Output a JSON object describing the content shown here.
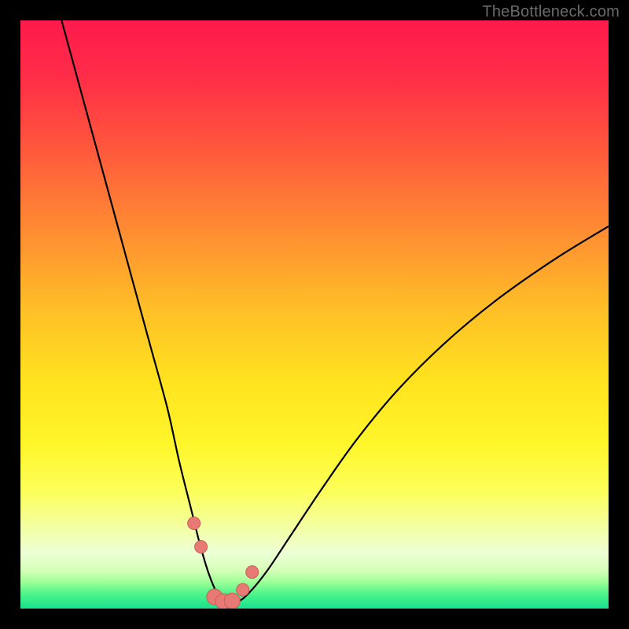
{
  "watermark": "TheBottleneck.com",
  "colors": {
    "frame_bg": "#000000",
    "curve": "#000000",
    "marker_fill": "#e77a75",
    "marker_stroke": "#cf5b56",
    "gradient_stops": [
      {
        "offset": 0.0,
        "color": "#ff1a4c"
      },
      {
        "offset": 0.1,
        "color": "#ff2e47"
      },
      {
        "offset": 0.22,
        "color": "#ff593c"
      },
      {
        "offset": 0.35,
        "color": "#ff8a33"
      },
      {
        "offset": 0.5,
        "color": "#ffc226"
      },
      {
        "offset": 0.62,
        "color": "#ffe41f"
      },
      {
        "offset": 0.72,
        "color": "#fff62a"
      },
      {
        "offset": 0.8,
        "color": "#fcff5a"
      },
      {
        "offset": 0.86,
        "color": "#f3ffa0"
      },
      {
        "offset": 0.905,
        "color": "#edffd6"
      },
      {
        "offset": 0.935,
        "color": "#d6ffb8"
      },
      {
        "offset": 0.955,
        "color": "#9dff97"
      },
      {
        "offset": 0.975,
        "color": "#4cf58a"
      },
      {
        "offset": 1.0,
        "color": "#19e08e"
      }
    ]
  },
  "chart_data": {
    "type": "line",
    "title": "",
    "xlabel": "",
    "ylabel": "",
    "xlim": [
      0,
      100
    ],
    "ylim": [
      0,
      100
    ],
    "grid": false,
    "series": [
      {
        "name": "bottleneck-curve",
        "x": [
          7,
          10,
          13,
          16,
          19,
          22,
          25,
          27,
          29,
          30.5,
          32,
          33.5,
          35,
          37,
          39,
          42,
          46,
          51,
          57,
          64,
          72,
          81,
          91,
          100
        ],
        "y": [
          100,
          89,
          78,
          67,
          56,
          45,
          34,
          25,
          17,
          11,
          6,
          2.5,
          1.2,
          1.2,
          2.8,
          6.5,
          12.5,
          20,
          28.5,
          37,
          45,
          52.5,
          59.5,
          65
        ]
      }
    ],
    "markers": {
      "name": "highlight-points",
      "x": [
        29.5,
        30.7,
        33.0,
        34.5,
        36.0,
        37.8,
        39.4
      ],
      "y": [
        14.5,
        10.5,
        2.0,
        1.2,
        1.3,
        3.2,
        6.2
      ],
      "r": [
        8,
        8,
        10,
        10,
        10,
        8,
        8
      ]
    }
  }
}
